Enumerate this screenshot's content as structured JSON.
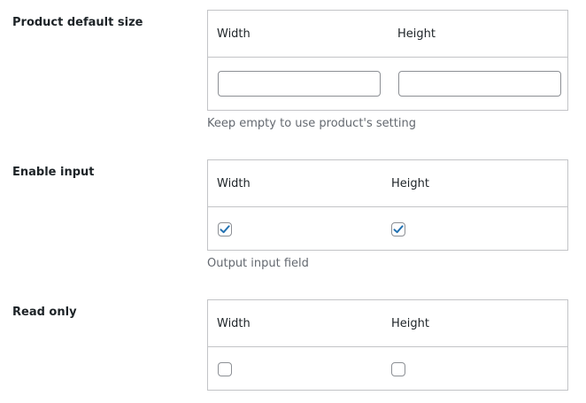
{
  "sections": [
    {
      "label": "Product default size",
      "type": "text",
      "columns": [
        "Width",
        "Height"
      ],
      "values": [
        "",
        ""
      ],
      "description": "Keep empty to use product's setting"
    },
    {
      "label": "Enable input",
      "type": "checkbox",
      "columns": [
        "Width",
        "Height"
      ],
      "checked": [
        true,
        true
      ],
      "description": "Output input field"
    },
    {
      "label": "Read only",
      "type": "checkbox",
      "columns": [
        "Width",
        "Height"
      ],
      "checked": [
        false,
        false
      ]
    }
  ],
  "colors": {
    "border": "#c3c4c7",
    "input_border": "#8c8f94",
    "check": "#2271b1",
    "description": "#646970"
  },
  "icons": {
    "checked": "check-icon"
  }
}
